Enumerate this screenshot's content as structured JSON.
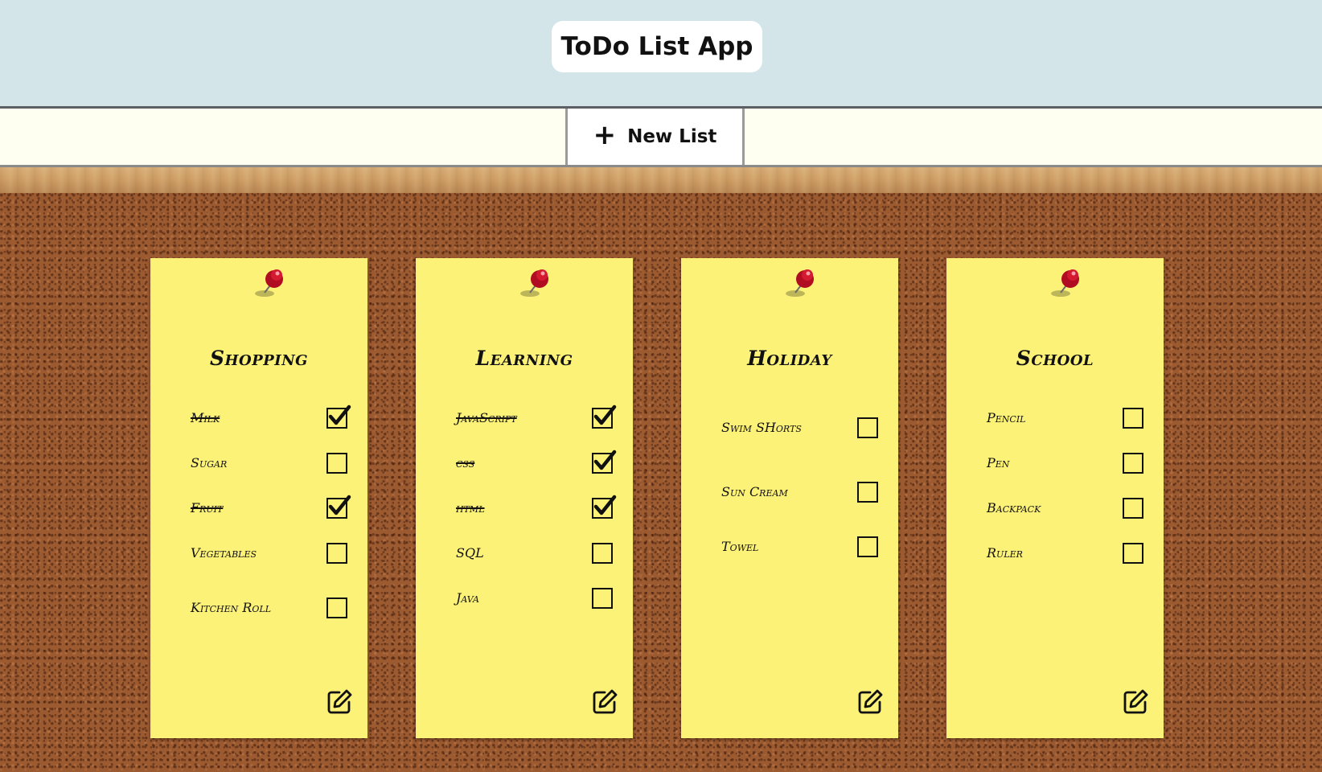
{
  "header": {
    "title": "ToDo List App",
    "bg_color": "#d4e5e9"
  },
  "toolbar": {
    "new_list_label": "New List",
    "new_list_icon": "plus-icon"
  },
  "colors": {
    "note": "#fdf278",
    "cork": "#9c5a30",
    "pin": "#c8102e"
  },
  "lists": [
    {
      "title": "Shopping",
      "items": [
        {
          "label": "Milk",
          "done": true
        },
        {
          "label": "Sugar",
          "done": false
        },
        {
          "label": "Fruit",
          "done": true
        },
        {
          "label": "Vegetables",
          "done": false
        },
        {
          "label": "Kitchen Roll",
          "done": false
        }
      ]
    },
    {
      "title": "Learning",
      "items": [
        {
          "label": "JavaScript",
          "done": true
        },
        {
          "label": "css",
          "done": true
        },
        {
          "label": "html",
          "done": true
        },
        {
          "label": "SQL",
          "done": false
        },
        {
          "label": "Java",
          "done": false
        }
      ]
    },
    {
      "title": "Holiday",
      "items": [
        {
          "label": "Swim SHorts",
          "done": false
        },
        {
          "label": "Sun Cream",
          "done": false
        },
        {
          "label": "Towel",
          "done": false
        }
      ]
    },
    {
      "title": "School",
      "items": [
        {
          "label": "Pencil",
          "done": false
        },
        {
          "label": "Pen",
          "done": false
        },
        {
          "label": "Backpack",
          "done": false
        },
        {
          "label": "Ruler",
          "done": false
        }
      ]
    }
  ]
}
